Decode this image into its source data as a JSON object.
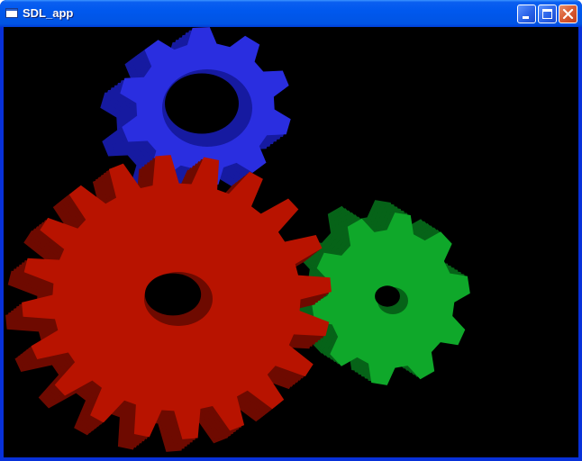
{
  "window": {
    "title": "SDL_app",
    "icon": "window-icon",
    "controls": [
      "minimize-icon",
      "maximize-icon",
      "close-icon"
    ]
  },
  "scene": {
    "background": "#000000",
    "gears": [
      {
        "name": "gear-blue",
        "color": "#2a2ee0",
        "shade": "#161aa0",
        "teeth": 10
      },
      {
        "name": "gear-red",
        "color": "#b81300",
        "shade": "#6e0a00",
        "teeth": 20
      },
      {
        "name": "gear-green",
        "color": "#0fa82a",
        "shade": "#066318",
        "teeth": 10
      }
    ]
  },
  "colors": {
    "titlebar": "#0054e3",
    "frame": "#0831d9",
    "close": "#d85a32"
  }
}
